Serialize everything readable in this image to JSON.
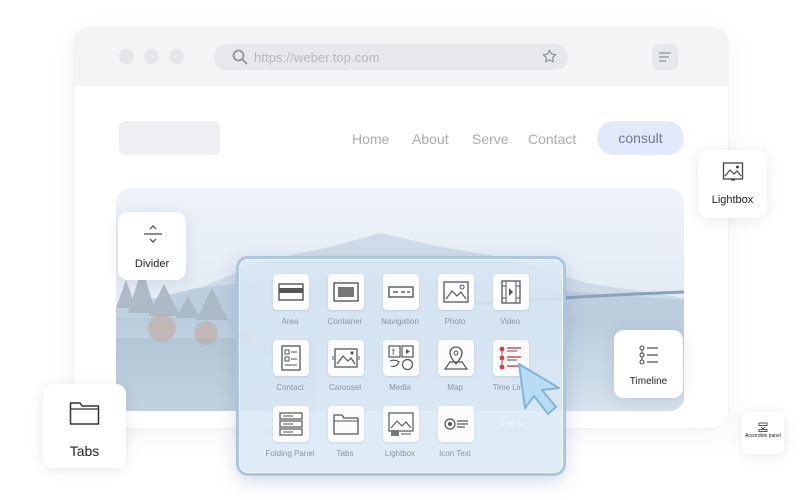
{
  "browser": {
    "url": "https://weber.top.com",
    "nav": [
      "Home",
      "About",
      "Serve",
      "Contact"
    ],
    "cta": "consult"
  },
  "cards": {
    "lightbox": "Lightbox",
    "divider": "Divider",
    "timeline": "Timeline",
    "tabs": "Tabs",
    "accordion": "Accordion panel"
  },
  "panel": {
    "items": [
      {
        "label": "Area",
        "icon": "area-icon"
      },
      {
        "label": "Container",
        "icon": "container-icon"
      },
      {
        "label": "Navigation",
        "icon": "navigation-icon"
      },
      {
        "label": "Photo",
        "icon": "photo-icon"
      },
      {
        "label": "Video",
        "icon": "video-icon"
      },
      {
        "label": "Contact",
        "icon": "contact-form-icon"
      },
      {
        "label": "Carousel",
        "icon": "carousel-icon"
      },
      {
        "label": "Media",
        "icon": "media-icon"
      },
      {
        "label": "Map",
        "icon": "map-pin-icon"
      },
      {
        "label": "Time Line",
        "icon": "timeline-icon"
      },
      {
        "label": "Folding Panel",
        "icon": "folding-panel-icon"
      },
      {
        "label": "Tabs",
        "icon": "tabs-folder-icon"
      },
      {
        "label": "Lightbox",
        "icon": "lightbox-icon"
      },
      {
        "label": "Icon Text",
        "icon": "icon-text-icon"
      }
    ]
  },
  "colors": {
    "accent": "#e2e9fb",
    "timeline_red": "#e03a3a",
    "panel_border": "#a9c6e2"
  }
}
